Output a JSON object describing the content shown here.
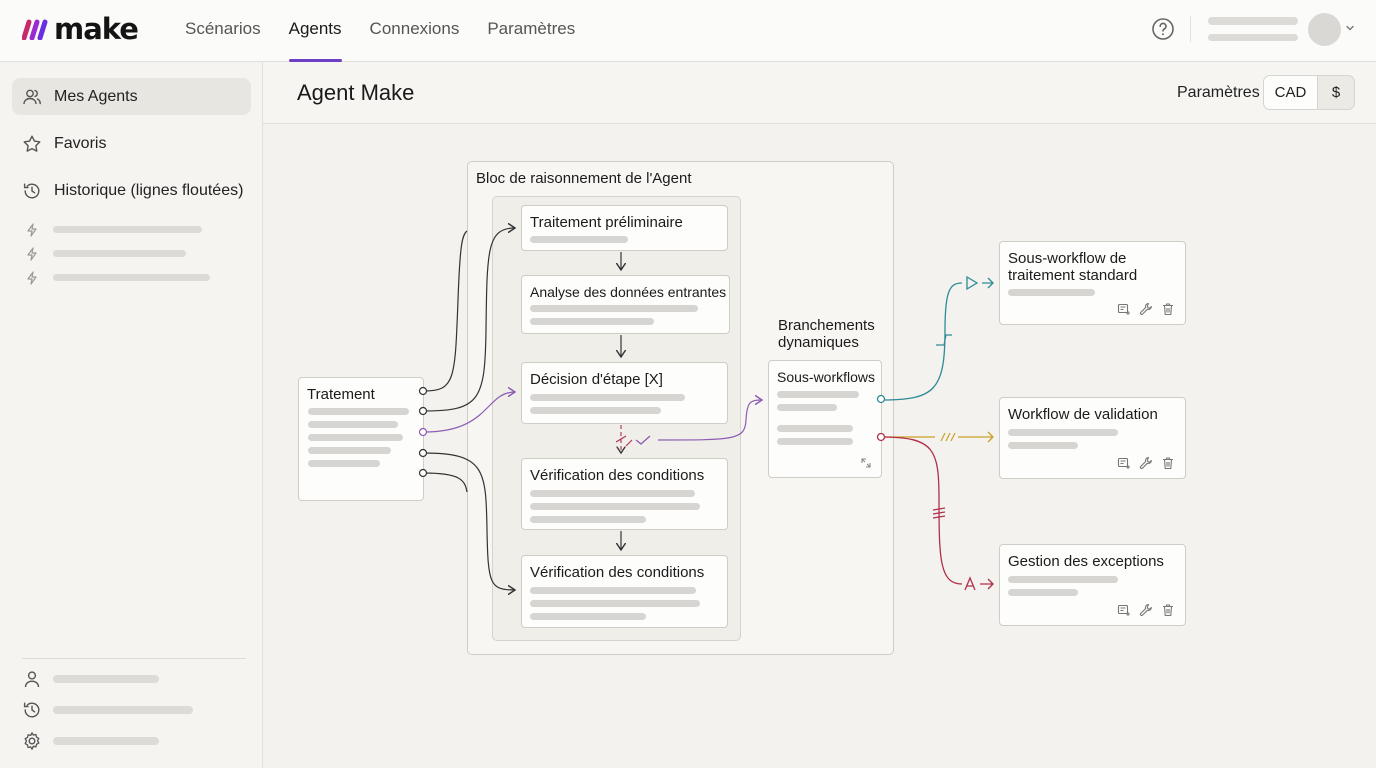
{
  "brand": {
    "name": "make"
  },
  "nav": [
    {
      "label": "Scénarios"
    },
    {
      "label": "Agents",
      "active": true
    },
    {
      "label": "Connexions"
    },
    {
      "label": "Paramètres"
    }
  ],
  "sidebar": {
    "items": [
      {
        "label": "Mes Agents",
        "icon": "users-icon",
        "active": true
      },
      {
        "label": "Favoris",
        "icon": "star-icon"
      },
      {
        "label": "Historique (lignes floutées)",
        "icon": "history-icon"
      }
    ]
  },
  "header": {
    "title": "Agent Make",
    "params_label": "Paramètres",
    "currency_options": [
      "CAD",
      "$"
    ],
    "currency_selected": "CAD"
  },
  "canvas": {
    "input_block": {
      "title": "Tratement"
    },
    "reasoning_block": {
      "title": "Bloc de raisonnement de l'Agent"
    },
    "steps": [
      {
        "title": "Traitement préliminaire"
      },
      {
        "title": "Analyse des données entrantes"
      },
      {
        "title": "Décision d'étape [X]"
      },
      {
        "title": "Vérification des conditions"
      },
      {
        "title": "Vérification des conditions"
      }
    ],
    "branching": {
      "label": "Branchements dynamiques",
      "box_title": "Sous-workflows"
    },
    "outputs": [
      {
        "title": "Sous-workflow de traitement standard",
        "color": "#2e8b95"
      },
      {
        "title": "Workflow de validation",
        "color": "#c9a227"
      },
      {
        "title": "Gestion des exceptions",
        "color": "#b0304a"
      }
    ],
    "accent_purple": "#8e5bb5"
  }
}
